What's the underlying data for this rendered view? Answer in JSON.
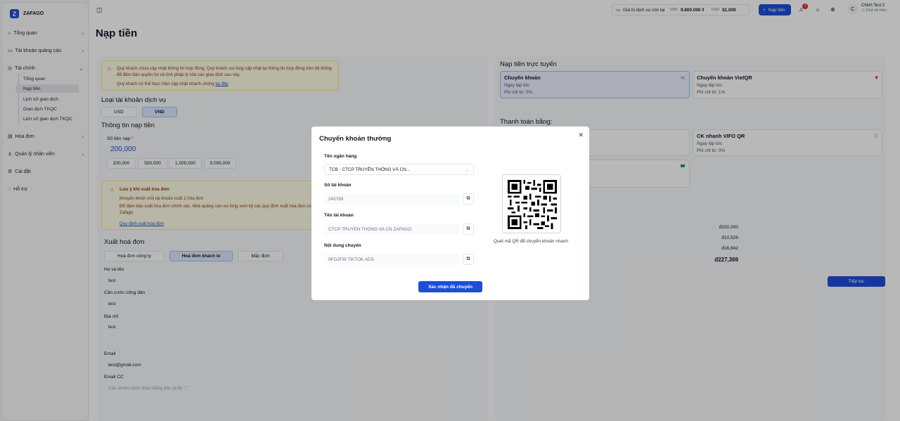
{
  "sidebar": {
    "brand": "ZAFAGO",
    "items": [
      {
        "label": "Tổng quan"
      },
      {
        "label": "Tài khoản quảng cáo"
      },
      {
        "label": "Tài chính"
      },
      {
        "label": "Hóa đơn"
      },
      {
        "label": "Quản lý nhân viên"
      },
      {
        "label": "Cài đặt"
      },
      {
        "label": "Hỗ trợ"
      }
    ],
    "finance_sub": [
      {
        "label": "Tổng quan"
      },
      {
        "label": "Nạp tiền"
      },
      {
        "label": "Lịch sử giao dịch"
      },
      {
        "label": "Giao dịch TKQC"
      },
      {
        "label": "Lịch sử giao dịch TKQC"
      }
    ]
  },
  "topbar": {
    "remaining_label": "Giá trị dịch vụ còn lại",
    "vnd_code": "VND",
    "vnd_value": "9.800.000 ₫",
    "usd_code": "USD",
    "usd_value": "$1,000",
    "topup_button": "Nạp tiền",
    "notification_count": "3",
    "avatar_initial": "C",
    "user_name": "Chinh Test 2",
    "user_status": "Chủ sở hữu"
  },
  "page": {
    "title": "Nạp tiền",
    "warning_text": "Quý khách chưa cập nhật thông tin hợp đồng. Quý khách vui lòng cập nhật lại thông tin hợp đồng trên hệ thống để đảm bảo quyền lợi và tính pháp lý của các giao dịch sau này.",
    "warning_text2_prefix": "Quý khách có thể thực hiện cập nhật nhanh chóng",
    "warning_link": "tại đây",
    "account_type_title": "Loại tài khoản dịch vụ",
    "account_types": [
      "USD",
      "VND"
    ],
    "topup_info_title": "Thông tin nạp tiền",
    "amount_label": "Số tiền nạp",
    "required_mark": "*",
    "amount_value": "200,000",
    "quick_amounts": [
      "200,000",
      "500,000",
      "1,000,000",
      "5,000,000"
    ],
    "invoice_note_title": "Lưu ý khi xuất hóa đơn",
    "invoice_note_1": "Khuyến khích mỗi tài khoản xuất 1 hóa đơn",
    "invoice_note_2": "Để đảm bảo xuất hóa đơn chính xác. Nhà quảng cáo vui lòng xem kỹ các quy định xuất hóa đơn của Zafago",
    "invoice_rules_link": "Quy định xuất hóa đơn",
    "export_invoice_title": "Xuất hoá đơn",
    "invoice_tabs": [
      "Hoá đơn công ty",
      "Hoá đơn khách lẻ",
      "Mặc định"
    ],
    "fields": {
      "fullname_label": "Họ và tên",
      "fullname_value": "test",
      "id_label": "Căn cước công dân",
      "id_value": "test",
      "address_label": "Địa chỉ",
      "address_value": "test",
      "email_label": "Email",
      "email_value": "test@gmail.com",
      "cc_label": "Email CC",
      "cc_placeholder": "Các email cách nhau bằng dấu phẩy \",\""
    },
    "online_title": "Nạp tiền trực tuyến",
    "methods": [
      {
        "title": "Chuyển khoản",
        "speed": "Ngay lập tức",
        "fee": "Phí chỉ từ: 0%"
      },
      {
        "title": "Chuyển khoản VietQR",
        "speed": "Ngay lập tức",
        "fee": "Phí chỉ từ: 1%"
      }
    ],
    "payment_title": "Thanh toán bằng:",
    "pay_methods": [
      {
        "title": "CK nhanh VIFO QR",
        "speed": "Ngay lập tức",
        "fee": "Phí chỉ từ: 0%"
      }
    ],
    "summary_values": [
      "đ200,000",
      "đ10,526",
      "đ16,842",
      "đ227,369"
    ],
    "continue_button": "Tiếp tục"
  },
  "modal": {
    "title": "Chuyển khoản thường",
    "bank_label": "Tên ngân hàng",
    "bank_value": "TCB - CTCP TRUYỀN THÔNG VÀ CN...",
    "account_no_label": "Số tài khoản",
    "account_no_value": "245789",
    "account_name_label": "Tên tài khoản",
    "account_name_value": "CTCP TRUYEN THONG VA CN ZAFAGO",
    "content_label": "Nội dung chuyển",
    "content_value": "9FOJFW TIKTOK ADS",
    "qr_caption": "Quét mã QR để chuyển khoản nhanh",
    "confirm_button": "Xác nhận đã chuyển"
  },
  "colors": {
    "primary": "#1d4ed8",
    "warning_bg": "#fefce8",
    "success": "#16a34a",
    "badge": "#dc2626"
  }
}
